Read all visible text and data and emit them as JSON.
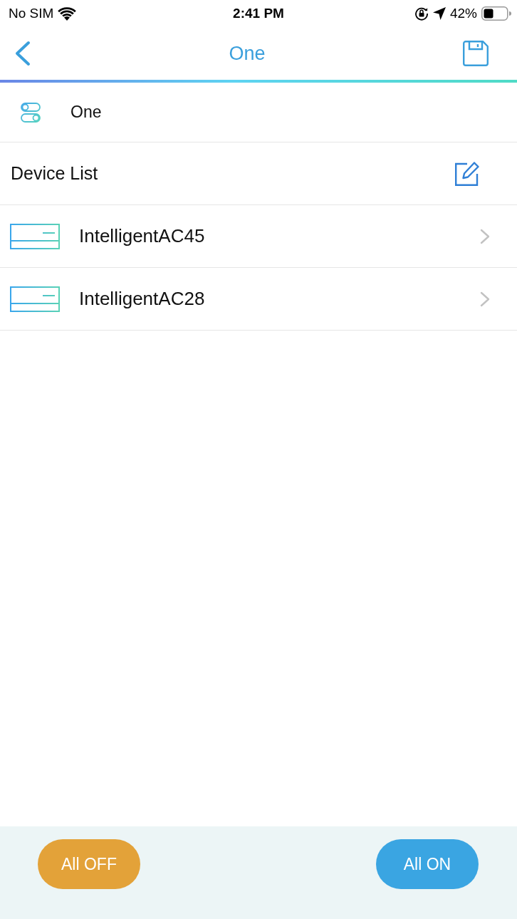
{
  "status_bar": {
    "carrier": "No SIM",
    "time": "2:41 PM",
    "battery_percent": "42%"
  },
  "nav_bar": {
    "title": "One"
  },
  "scene": {
    "name": "One"
  },
  "device_list": {
    "title": "Device List",
    "devices": [
      {
        "name": "IntelligentAC45"
      },
      {
        "name": "IntelligentAC28"
      }
    ]
  },
  "footer": {
    "buttons": [
      {
        "kind": "off",
        "label": "All OFF"
      },
      {
        "kind": "on",
        "label": "All ON"
      }
    ]
  }
}
